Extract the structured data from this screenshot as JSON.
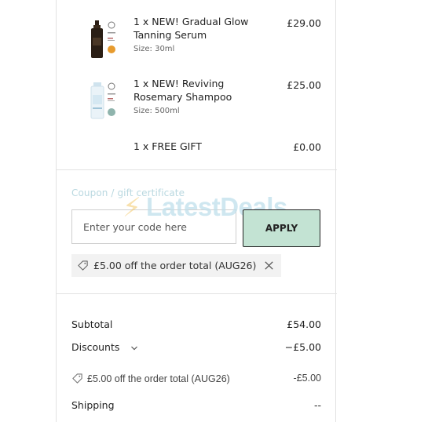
{
  "items": [
    {
      "title": "1 x NEW! Gradual Glow Tanning Serum",
      "size": "Size: 30ml",
      "price": "£29.00"
    },
    {
      "title": "1 x NEW! Reviving Rosemary Shampoo",
      "size": "Size: 500ml",
      "price": "£25.00"
    },
    {
      "title": "1 x FREE GIFT",
      "price": "£0.00"
    }
  ],
  "coupon": {
    "label": "Coupon / gift certificate",
    "placeholder": "Enter your code here",
    "apply_label": "APPLY",
    "applied_text": "£5.00 off the order total (AUG26)"
  },
  "watermark": {
    "text": "LatestDeals"
  },
  "summary": {
    "subtotal_label": "Subtotal",
    "subtotal_value": "£54.00",
    "discounts_label": "Discounts",
    "discounts_value": "−£5.00",
    "discount_detail_text": "£5.00 off the order total (AUG26)",
    "discount_detail_value": "-£5.00",
    "shipping_label": "Shipping",
    "shipping_value": "--"
  },
  "colors": {
    "apply_bg": "#c3e3d3",
    "coupon_label": "#b9d8e0",
    "chip_bg": "#f2f2f2"
  }
}
